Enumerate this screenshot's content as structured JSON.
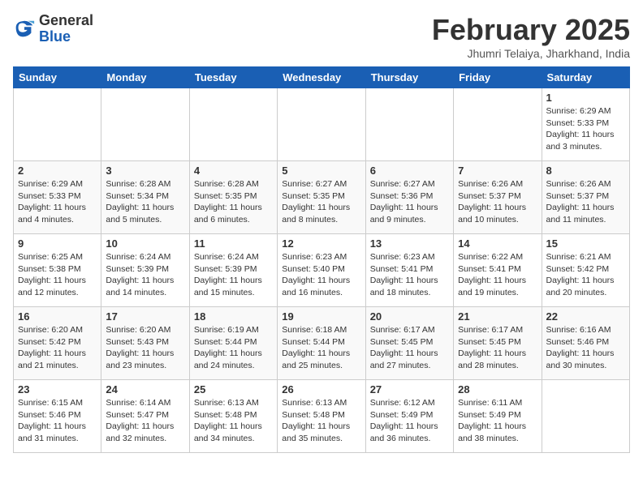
{
  "header": {
    "logo": {
      "general": "General",
      "blue": "Blue"
    },
    "title": "February 2025",
    "subtitle": "Jhumri Telaiya, Jharkhand, India"
  },
  "weekdays": [
    "Sunday",
    "Monday",
    "Tuesday",
    "Wednesday",
    "Thursday",
    "Friday",
    "Saturday"
  ],
  "weeks": [
    [
      {
        "day": "",
        "info": ""
      },
      {
        "day": "",
        "info": ""
      },
      {
        "day": "",
        "info": ""
      },
      {
        "day": "",
        "info": ""
      },
      {
        "day": "",
        "info": ""
      },
      {
        "day": "",
        "info": ""
      },
      {
        "day": "1",
        "info": "Sunrise: 6:29 AM\nSunset: 5:33 PM\nDaylight: 11 hours and 3 minutes."
      }
    ],
    [
      {
        "day": "2",
        "info": "Sunrise: 6:29 AM\nSunset: 5:33 PM\nDaylight: 11 hours and 4 minutes."
      },
      {
        "day": "3",
        "info": "Sunrise: 6:28 AM\nSunset: 5:34 PM\nDaylight: 11 hours and 5 minutes."
      },
      {
        "day": "4",
        "info": "Sunrise: 6:28 AM\nSunset: 5:35 PM\nDaylight: 11 hours and 6 minutes."
      },
      {
        "day": "5",
        "info": "Sunrise: 6:27 AM\nSunset: 5:35 PM\nDaylight: 11 hours and 8 minutes."
      },
      {
        "day": "6",
        "info": "Sunrise: 6:27 AM\nSunset: 5:36 PM\nDaylight: 11 hours and 9 minutes."
      },
      {
        "day": "7",
        "info": "Sunrise: 6:26 AM\nSunset: 5:37 PM\nDaylight: 11 hours and 10 minutes."
      },
      {
        "day": "8",
        "info": "Sunrise: 6:26 AM\nSunset: 5:37 PM\nDaylight: 11 hours and 11 minutes."
      }
    ],
    [
      {
        "day": "9",
        "info": "Sunrise: 6:25 AM\nSunset: 5:38 PM\nDaylight: 11 hours and 12 minutes."
      },
      {
        "day": "10",
        "info": "Sunrise: 6:24 AM\nSunset: 5:39 PM\nDaylight: 11 hours and 14 minutes."
      },
      {
        "day": "11",
        "info": "Sunrise: 6:24 AM\nSunset: 5:39 PM\nDaylight: 11 hours and 15 minutes."
      },
      {
        "day": "12",
        "info": "Sunrise: 6:23 AM\nSunset: 5:40 PM\nDaylight: 11 hours and 16 minutes."
      },
      {
        "day": "13",
        "info": "Sunrise: 6:23 AM\nSunset: 5:41 PM\nDaylight: 11 hours and 18 minutes."
      },
      {
        "day": "14",
        "info": "Sunrise: 6:22 AM\nSunset: 5:41 PM\nDaylight: 11 hours and 19 minutes."
      },
      {
        "day": "15",
        "info": "Sunrise: 6:21 AM\nSunset: 5:42 PM\nDaylight: 11 hours and 20 minutes."
      }
    ],
    [
      {
        "day": "16",
        "info": "Sunrise: 6:20 AM\nSunset: 5:42 PM\nDaylight: 11 hours and 21 minutes."
      },
      {
        "day": "17",
        "info": "Sunrise: 6:20 AM\nSunset: 5:43 PM\nDaylight: 11 hours and 23 minutes."
      },
      {
        "day": "18",
        "info": "Sunrise: 6:19 AM\nSunset: 5:44 PM\nDaylight: 11 hours and 24 minutes."
      },
      {
        "day": "19",
        "info": "Sunrise: 6:18 AM\nSunset: 5:44 PM\nDaylight: 11 hours and 25 minutes."
      },
      {
        "day": "20",
        "info": "Sunrise: 6:17 AM\nSunset: 5:45 PM\nDaylight: 11 hours and 27 minutes."
      },
      {
        "day": "21",
        "info": "Sunrise: 6:17 AM\nSunset: 5:45 PM\nDaylight: 11 hours and 28 minutes."
      },
      {
        "day": "22",
        "info": "Sunrise: 6:16 AM\nSunset: 5:46 PM\nDaylight: 11 hours and 30 minutes."
      }
    ],
    [
      {
        "day": "23",
        "info": "Sunrise: 6:15 AM\nSunset: 5:46 PM\nDaylight: 11 hours and 31 minutes."
      },
      {
        "day": "24",
        "info": "Sunrise: 6:14 AM\nSunset: 5:47 PM\nDaylight: 11 hours and 32 minutes."
      },
      {
        "day": "25",
        "info": "Sunrise: 6:13 AM\nSunset: 5:48 PM\nDaylight: 11 hours and 34 minutes."
      },
      {
        "day": "26",
        "info": "Sunrise: 6:13 AM\nSunset: 5:48 PM\nDaylight: 11 hours and 35 minutes."
      },
      {
        "day": "27",
        "info": "Sunrise: 6:12 AM\nSunset: 5:49 PM\nDaylight: 11 hours and 36 minutes."
      },
      {
        "day": "28",
        "info": "Sunrise: 6:11 AM\nSunset: 5:49 PM\nDaylight: 11 hours and 38 minutes."
      },
      {
        "day": "",
        "info": ""
      }
    ]
  ]
}
